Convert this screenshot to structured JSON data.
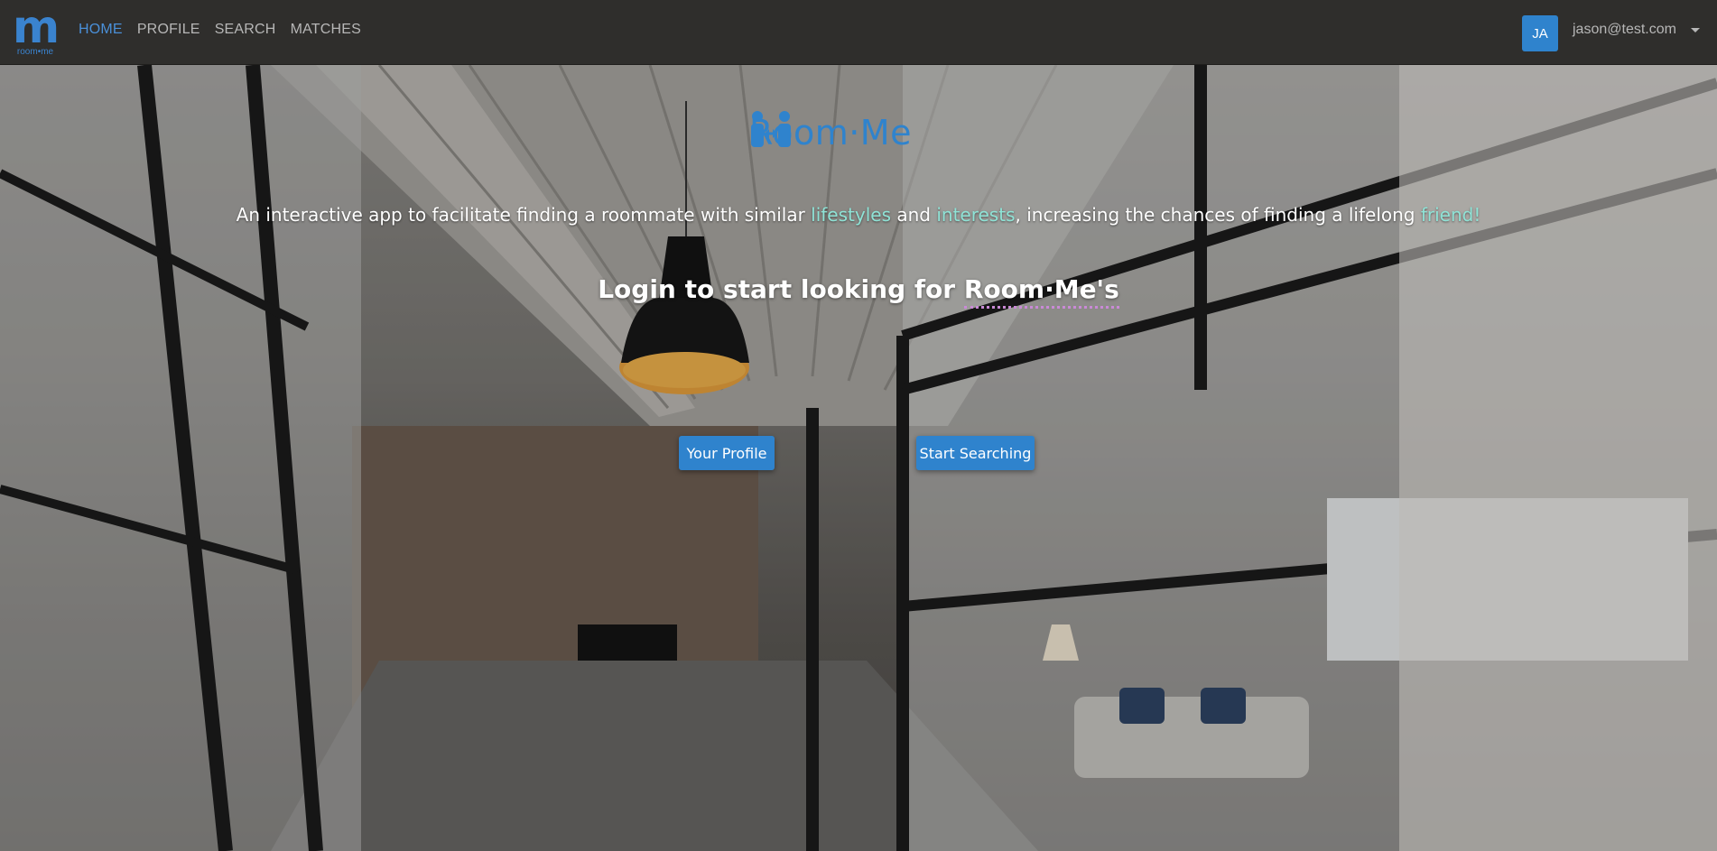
{
  "navbar": {
    "brand_letter": "m",
    "brand_sub": "room•me",
    "links": [
      {
        "label": "HOME",
        "active": true
      },
      {
        "label": "PROFILE",
        "active": false
      },
      {
        "label": "SEARCH",
        "active": false
      },
      {
        "label": "MATCHES",
        "active": false
      }
    ],
    "avatar_initials": "JA",
    "user_email": "jason@test.com"
  },
  "hero": {
    "logo_text": "Room·Me",
    "tagline_parts": [
      {
        "text": "An interactive app to facilitate finding a roommate with similar ",
        "highlight": false
      },
      {
        "text": "lifestyles",
        "highlight": true
      },
      {
        "text": " and ",
        "highlight": false
      },
      {
        "text": "interests",
        "highlight": true
      },
      {
        "text": ", increasing the chances of finding a lifelong ",
        "highlight": false
      },
      {
        "text": "friend!",
        "highlight": true
      }
    ],
    "login_heading_prefix": "Login to start looking for ",
    "login_heading_brand": "Room·Me's",
    "buttons": {
      "profile": "Your Profile",
      "search": "Start Searching"
    }
  },
  "colors": {
    "navbar_bg": "#2f2e2c",
    "accent": "#2f83cd",
    "highlight": "#8fe3d6",
    "dotted_underline": "#c98ad6"
  }
}
